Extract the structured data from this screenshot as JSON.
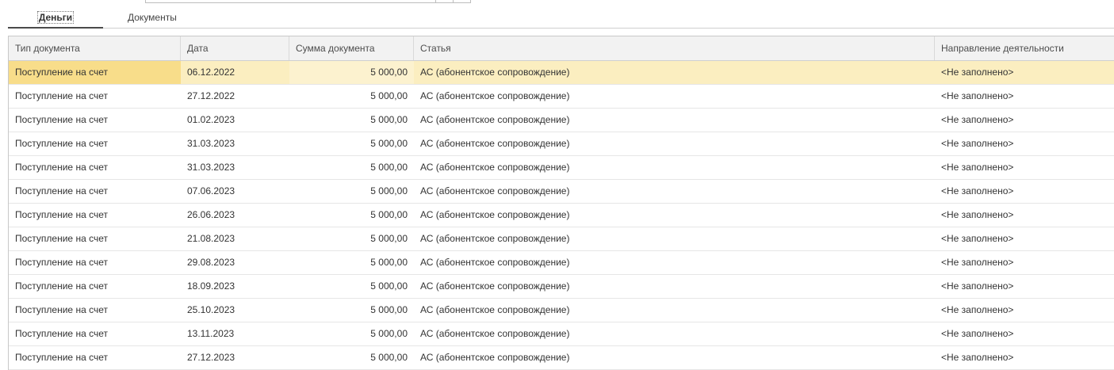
{
  "tabs": [
    {
      "label": "Деньги",
      "active": true
    },
    {
      "label": "Документы",
      "active": false
    }
  ],
  "table": {
    "columns": [
      "Тип документа",
      "Дата",
      "Сумма документа",
      "Статья",
      "Направление деятельности"
    ],
    "rows": [
      [
        "Поступление на счет",
        "06.12.2022",
        "5 000,00",
        "АС (абонентское сопровождение)",
        "<Не заполнено>"
      ],
      [
        "Поступление на счет",
        "27.12.2022",
        "5 000,00",
        "АС (абонентское сопровождение)",
        "<Не заполнено>"
      ],
      [
        "Поступление на счет",
        "01.02.2023",
        "5 000,00",
        "АС (абонентское сопровождение)",
        "<Не заполнено>"
      ],
      [
        "Поступление на счет",
        "31.03.2023",
        "5 000,00",
        "АС (абонентское сопровождение)",
        "<Не заполнено>"
      ],
      [
        "Поступление на счет",
        "31.03.2023",
        "5 000,00",
        "АС (абонентское сопровождение)",
        "<Не заполнено>"
      ],
      [
        "Поступление на счет",
        "07.06.2023",
        "5 000,00",
        "АС (абонентское сопровождение)",
        "<Не заполнено>"
      ],
      [
        "Поступление на счет",
        "26.06.2023",
        "5 000,00",
        "АС (абонентское сопровождение)",
        "<Не заполнено>"
      ],
      [
        "Поступление на счет",
        "21.08.2023",
        "5 000,00",
        "АС (абонентское сопровождение)",
        "<Не заполнено>"
      ],
      [
        "Поступление на счет",
        "29.08.2023",
        "5 000,00",
        "АС (абонентское сопровождение)",
        "<Не заполнено>"
      ],
      [
        "Поступление на счет",
        "18.09.2023",
        "5 000,00",
        "АС (абонентское сопровождение)",
        "<Не заполнено>"
      ],
      [
        "Поступление на счет",
        "25.10.2023",
        "5 000,00",
        "АС (абонентское сопровождение)",
        "<Не заполнено>"
      ],
      [
        "Поступление на счет",
        "13.11.2023",
        "5 000,00",
        "АС (абонентское сопровождение)",
        "<Не заполнено>"
      ],
      [
        "Поступление на счет",
        "27.12.2023",
        "5 000,00",
        "АС (абонентское сопровождение)",
        "<Не заполнено>"
      ]
    ],
    "selected_row": 0
  },
  "colors": {
    "selected_row": "#fbeec0",
    "selected_cell": "#f8dd8a",
    "header_bg": "#f2f2f2"
  }
}
